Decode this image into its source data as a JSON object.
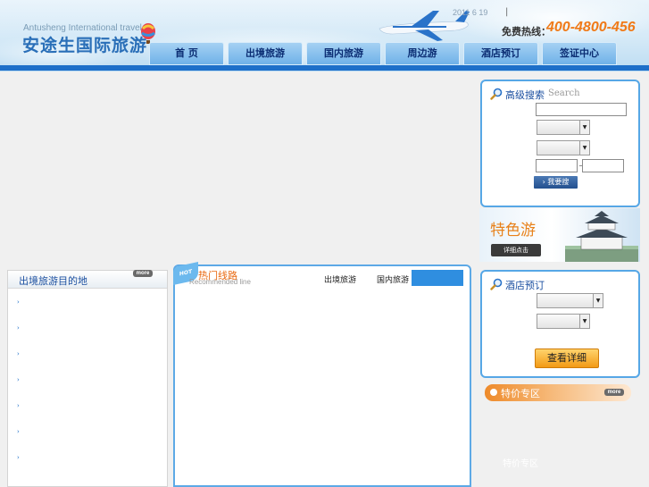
{
  "header": {
    "logo_en": "Antusheng International travel",
    "logo_cn": "安途生国际旅游",
    "date": "2011 6 19",
    "separator": "|",
    "hotline_label": "免费热线：",
    "hotline_number": "400-4800-456"
  },
  "nav": {
    "items": [
      {
        "label": "首 页"
      },
      {
        "label": "出境旅游"
      },
      {
        "label": "国内旅游"
      },
      {
        "label": "周边游"
      },
      {
        "label": "酒店预订"
      },
      {
        "label": "签证中心"
      }
    ]
  },
  "left_panel": {
    "title": "出境旅游目的地",
    "more": "more",
    "bullet": "›",
    "item_count_visible": 7
  },
  "center_panel": {
    "hot_badge": "HOT",
    "title": "热门线路",
    "subtitle": "Recommended line",
    "tabs": [
      "出境旅游",
      "国内旅游",
      ""
    ]
  },
  "search_box": {
    "title": "高级搜索",
    "title_en": "Search",
    "range_separator": "~",
    "search_button": "我要搜",
    "icon": "magnifier-icon"
  },
  "promo": {
    "title": "特色游",
    "button": "详细点击"
  },
  "hotel_box": {
    "title": "酒店预订",
    "detail_button": "查看详细"
  },
  "special": {
    "title": "特价专区",
    "more": "more",
    "footer_text": "特价专区"
  },
  "colors": {
    "nav_blue": "#1d6fc9",
    "accent_orange": "#f07a17",
    "panel_border": "#56a7e6"
  }
}
